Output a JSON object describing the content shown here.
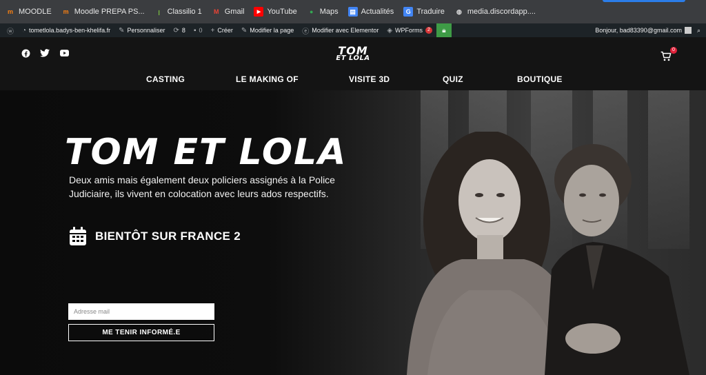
{
  "bookmarks": [
    {
      "label": "MOODLE",
      "icon": "moodle-icon",
      "color": "#f98012"
    },
    {
      "label": "Moodle PREPA PS...",
      "icon": "moodle-icon",
      "color": "#f98012"
    },
    {
      "label": "Classilio 1",
      "icon": "classilio-icon",
      "color": "#7cc242"
    },
    {
      "label": "Gmail",
      "icon": "gmail-icon",
      "color": "#ea4335"
    },
    {
      "label": "YouTube",
      "icon": "youtube-icon",
      "color": "#ff0000"
    },
    {
      "label": "Maps",
      "icon": "maps-icon",
      "color": "#34a853"
    },
    {
      "label": "Actualités",
      "icon": "news-icon",
      "color": "#4285f4"
    },
    {
      "label": "Traduire",
      "icon": "translate-icon",
      "color": "#4285f4"
    },
    {
      "label": "media.discordapp....",
      "icon": "globe-icon",
      "color": "#bbbbbb"
    }
  ],
  "adminbar": {
    "site": "tometlola.badys-ben-khelifa.fr",
    "customize": "Personnaliser",
    "updates": "8",
    "comments": "0",
    "new": "Créer",
    "edit": "Modifier la page",
    "elementor": "Modifier avec Elementor",
    "wpforms": "WPForms",
    "wpforms_count": "2",
    "greeting": "Bonjour, bad83390@gmail.com"
  },
  "header": {
    "logo_line1": "TOM",
    "logo_line2": "ET LOLA",
    "cart_count": "0",
    "nav": [
      "CASTING",
      "LE MAKING OF",
      "VISITE 3D",
      "QUIZ",
      "BOUTIQUE"
    ]
  },
  "hero": {
    "title": "TOM ET LOLA",
    "description": "Deux amis mais également deux policiers assignés à la Police Judiciaire, ils vivent en colocation avec leurs ados respectifs.",
    "date_text": "BIENTÔT SUR FRANCE 2",
    "email_placeholder": "Adresse mail",
    "cta_label": "ME TENIR INFORMÉ.E"
  },
  "colors": {
    "accent_badge": "#e0213a",
    "admin_bg": "#1d2327",
    "lock_green": "#3e9b46"
  }
}
